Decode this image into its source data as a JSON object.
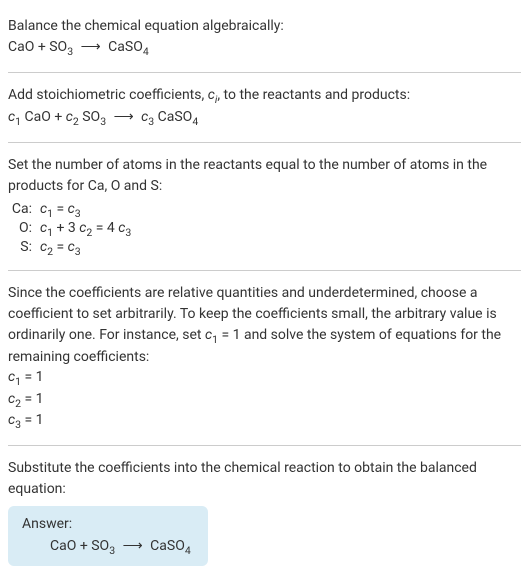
{
  "section1": {
    "title": "Balance the chemical equation algebraically:",
    "eq_left1": "CaO + SO",
    "eq_sub1": "3",
    "eq_arrow": "⟶",
    "eq_right1": "CaSO",
    "eq_sub2": "4"
  },
  "section2": {
    "title_part1": "Add stoichiometric coefficients, ",
    "title_ci": "c",
    "title_ci_sub": "i",
    "title_part2": ", to the reactants and products:",
    "c1": "c",
    "c1_sub": "1",
    "t1": " CaO + ",
    "c2": "c",
    "c2_sub": "2",
    "t2": " SO",
    "t2_sub": "3",
    "arrow": "⟶",
    "c3": "c",
    "c3_sub": "3",
    "t3": " CaSO",
    "t3_sub": "4"
  },
  "section3": {
    "title": "Set the number of atoms in the reactants equal to the number of atoms in the products for Ca, O and S:",
    "rows": [
      {
        "label": "Ca:",
        "c1": "c",
        "c1s": "1",
        "mid": " = ",
        "c2": "c",
        "c2s": "3"
      },
      {
        "label": "O:",
        "c1": "c",
        "c1s": "1",
        "mid": " + 3 ",
        "c2": "c",
        "c2s": "2",
        "mid2": " = 4 ",
        "c3": "c",
        "c3s": "3"
      },
      {
        "label": "S:",
        "c1": "c",
        "c1s": "2",
        "mid": " = ",
        "c2": "c",
        "c2s": "3"
      }
    ]
  },
  "section4": {
    "text_part1": "Since the coefficients are relative quantities and underdetermined, choose a coefficient to set arbitrarily. To keep the coefficients small, the arbitrary value is ordinarily one. For instance, set ",
    "cvar": "c",
    "cvar_sub": "1",
    "text_part2": " = 1 and solve the system of equations for the remaining coefficients:",
    "coeffs": [
      {
        "c": "c",
        "s": "1",
        "v": " = 1"
      },
      {
        "c": "c",
        "s": "2",
        "v": " = 1"
      },
      {
        "c": "c",
        "s": "3",
        "v": " = 1"
      }
    ]
  },
  "section5": {
    "title": "Substitute the coefficients into the chemical reaction to obtain the balanced equation:"
  },
  "answer": {
    "label": "Answer:",
    "eq_l": "CaO + SO",
    "eq_ls": "3",
    "arrow": "⟶",
    "eq_r": "CaSO",
    "eq_rs": "4"
  }
}
